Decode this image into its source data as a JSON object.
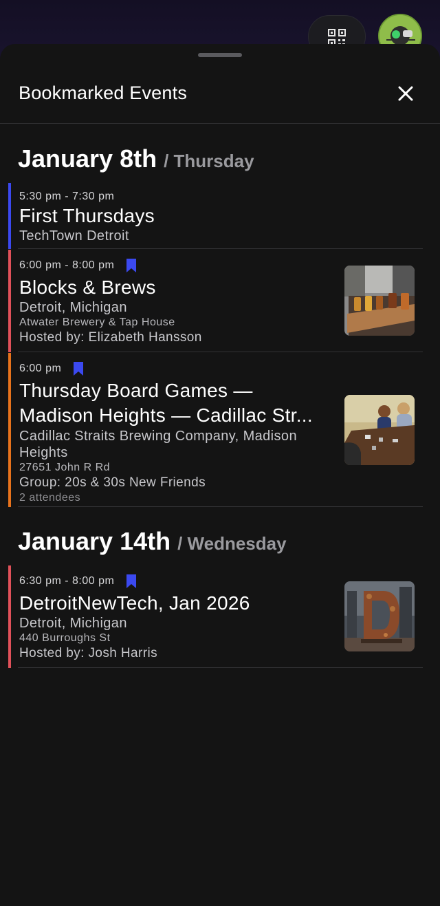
{
  "sheet": {
    "title": "Bookmarked Events"
  },
  "colors": {
    "blue": "#3b49f0",
    "red": "#e0515a",
    "orange": "#e8731c",
    "bookmark": "#3b49f0"
  },
  "days": [
    {
      "date": "January 8th",
      "weekday": "/ Thursday",
      "events": [
        {
          "time": "5:30 pm - 7:30 pm",
          "title": "First Thursdays",
          "location": "TechTown Detroit"
        },
        {
          "time": "6:00 pm - 8:00 pm",
          "title": "Blocks & Brews",
          "location": "Detroit, Michigan",
          "address": "Atwater Brewery & Tap House",
          "host": "Hosted by: Elizabeth Hansson"
        },
        {
          "time": "6:00 pm",
          "title_line1": "Thursday Board Games —",
          "title_line2": "Madison Heights — Cadillac Str...",
          "location_line1": "Cadillac Straits Brewing Company, Madison",
          "location_line2": "Heights",
          "address": "27651 John R Rd",
          "host": "Group: 20s & 30s New Friends",
          "attendees": "2 attendees"
        }
      ]
    },
    {
      "date": "January 14th",
      "weekday": "/ Wednesday",
      "events": [
        {
          "time": "6:30 pm - 8:00 pm",
          "title": "DetroitNewTech, Jan 2026",
          "location": "Detroit, Michigan",
          "address": "440 Burroughs St",
          "host": "Hosted by: Josh Harris"
        }
      ]
    }
  ]
}
